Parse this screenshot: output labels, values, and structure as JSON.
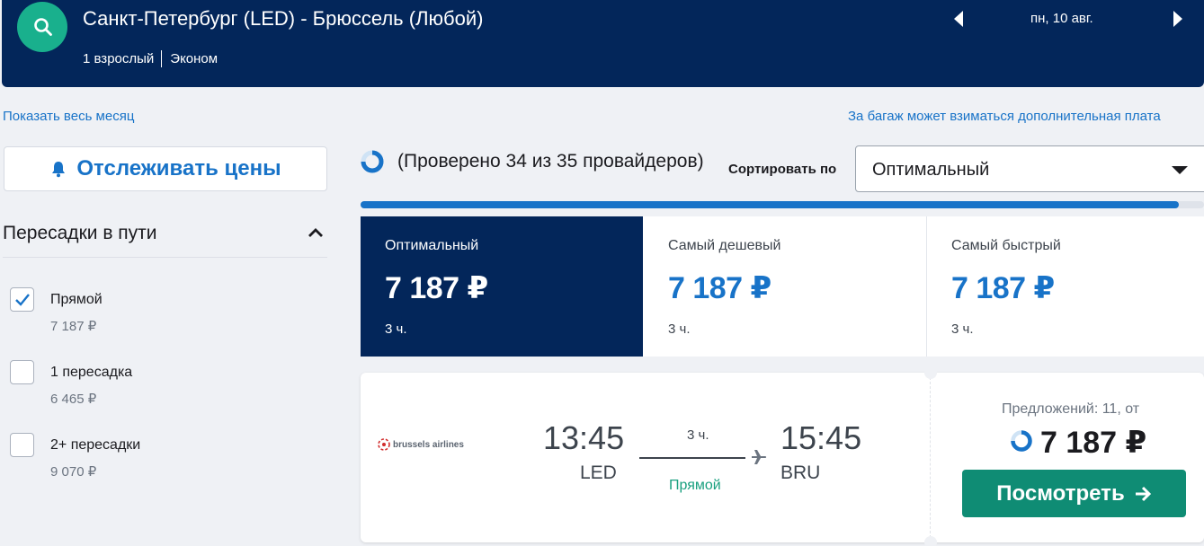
{
  "header": {
    "route": "Санкт-Петербург (LED) - Брюссель (Любой)",
    "passengers": "1 взрослый",
    "cabin": "Эконом",
    "date": "пн, 10 авг."
  },
  "links": {
    "whole_month": "Показать весь месяц",
    "baggage_note": "За багаж может взиматься дополнительная плата"
  },
  "track_prices": {
    "label": "Отслеживать цены"
  },
  "filters": {
    "stops": {
      "title": "Пересадки в пути",
      "options": [
        {
          "label": "Прямой",
          "price": "7 187 ₽",
          "checked": true
        },
        {
          "label": "1 пересадка",
          "price": "6 465 ₽",
          "checked": false
        },
        {
          "label": "2+ пересадки",
          "price": "9 070 ₽",
          "checked": false
        }
      ]
    }
  },
  "status": {
    "checked_providers": "(Проверено 34 из 35 провайдеров)",
    "progress_percent": 97
  },
  "sort": {
    "label": "Сортировать по",
    "selected": "Оптимальный"
  },
  "sort_tabs": [
    {
      "name": "Оптимальный",
      "price": "7 187 ₽",
      "duration": "3 ч.",
      "active": true
    },
    {
      "name": "Самый дешевый",
      "price": "7 187 ₽",
      "duration": "3 ч.",
      "active": false
    },
    {
      "name": "Самый быстрый",
      "price": "7 187 ₽",
      "duration": "3 ч.",
      "active": false
    }
  ],
  "result": {
    "airline": "brussels airlines",
    "departure_time": "13:45",
    "departure_code": "LED",
    "arrival_time": "15:45",
    "arrival_code": "BRU",
    "duration": "3 ч.",
    "stops": "Прямой",
    "offers": "Предложений: 11, от",
    "price": "7 187 ₽",
    "button": "Посмотреть"
  },
  "colors": {
    "header_bg": "#03265a",
    "accent_blue": "#1873c8",
    "green_button": "#0f8c74",
    "search_circle": "#19b08d"
  }
}
